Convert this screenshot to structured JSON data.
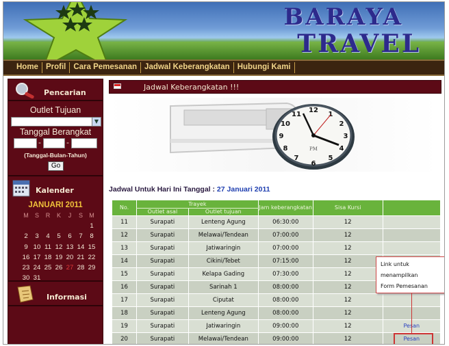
{
  "header": {
    "brand_line1": "BARAYA",
    "brand_line2": "TRAVEL"
  },
  "nav": {
    "items": [
      "Home",
      "Profil",
      "Cara Pemesanan",
      "Jadwal Keberangkatan",
      "Hubungi Kami"
    ]
  },
  "sidebar": {
    "search": {
      "title": "Pencarian",
      "outlet_label": "Outlet Tujuan",
      "outlet_value": "",
      "date_label": "Tanggal Berangkat",
      "date_hint": "(Tanggal-Bulan-Tahun)",
      "go_label": "Go"
    },
    "calendar": {
      "title": "Kalender",
      "month": "JANUARI 2011",
      "days_of_week": [
        "M",
        "S",
        "R",
        "K",
        "J",
        "S",
        "M"
      ],
      "today": "27",
      "cells": [
        "",
        "",
        "",
        "",
        "",
        "",
        "1",
        "2",
        "3",
        "4",
        "5",
        "6",
        "7",
        "8",
        "9",
        "10",
        "11",
        "12",
        "13",
        "14",
        "15",
        "16",
        "17",
        "18",
        "19",
        "20",
        "21",
        "22",
        "23",
        "24",
        "25",
        "26",
        "27",
        "28",
        "29",
        "30",
        "31",
        "",
        "",
        "",
        "",
        ""
      ]
    },
    "info": {
      "title": "Informasi"
    }
  },
  "main": {
    "section_title": "Jadwal Keberangkatan !!!",
    "schedule_prefix": "Jadwal Untuk Hari Ini Tanggal :",
    "schedule_date": "27 Januari 2011",
    "table": {
      "col_no": "No.",
      "col_trayek": "Trayek",
      "col_outlet_asal": "Outlet asal",
      "col_outlet_tujuan": "Outlet tujuan",
      "col_jam": "Jam keberangkatan",
      "col_sisa": "Sisa Kursi",
      "rows": [
        {
          "no": "11",
          "asal": "Surapati",
          "tujuan": "Lenteng Agung",
          "jam": "06:30:00",
          "sisa": "12",
          "aksi": ""
        },
        {
          "no": "12",
          "asal": "Surapati",
          "tujuan": "Melawai/Tendean",
          "jam": "07:00:00",
          "sisa": "12",
          "aksi": ""
        },
        {
          "no": "13",
          "asal": "Surapati",
          "tujuan": "Jatiwaringin",
          "jam": "07:00:00",
          "sisa": "12",
          "aksi": ""
        },
        {
          "no": "14",
          "asal": "Surapati",
          "tujuan": "Cikini/Tebet",
          "jam": "07:15:00",
          "sisa": "12",
          "aksi": ""
        },
        {
          "no": "15",
          "asal": "Surapati",
          "tujuan": "Kelapa Gading",
          "jam": "07:30:00",
          "sisa": "12",
          "aksi": ""
        },
        {
          "no": "16",
          "asal": "Surapati",
          "tujuan": "Sarinah 1",
          "jam": "08:00:00",
          "sisa": "12",
          "aksi": ""
        },
        {
          "no": "17",
          "asal": "Surapati",
          "tujuan": "Ciputat",
          "jam": "08:00:00",
          "sisa": "12",
          "aksi": ""
        },
        {
          "no": "18",
          "asal": "Surapati",
          "tujuan": "Lenteng Agung",
          "jam": "08:00:00",
          "sisa": "12",
          "aksi": ""
        },
        {
          "no": "19",
          "asal": "Surapati",
          "tujuan": "Jatiwaringin",
          "jam": "09:00:00",
          "sisa": "12",
          "aksi": "Pesan"
        },
        {
          "no": "20",
          "asal": "Surapati",
          "tujuan": "Melawai/Tendean",
          "jam": "09:00:00",
          "sisa": "12",
          "aksi": "Pesan"
        }
      ]
    }
  },
  "annotation": {
    "lines": [
      "Link untuk",
      "menampilkan",
      "Form Pemesanan"
    ]
  },
  "colors": {
    "sidebar_bg": "#5c0a16",
    "nav_bg": "#3b2410",
    "table_header": "#69b33c",
    "brand_text": "#2d2a8c",
    "link": "#2a40c0",
    "today": "#e23a3a"
  }
}
